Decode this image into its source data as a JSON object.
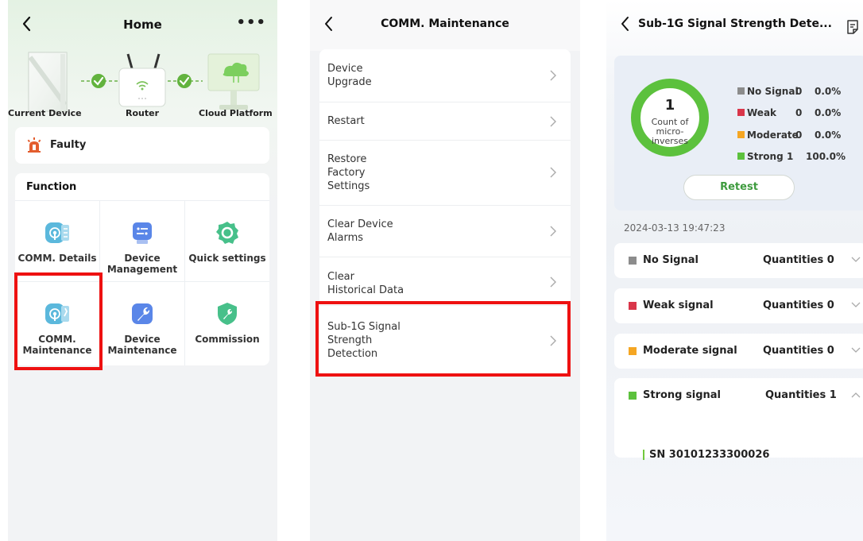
{
  "panel1": {
    "title": "Home",
    "more": "•••",
    "topology": {
      "current_device": "Current Device",
      "router": "Router",
      "cloud_platform": "Cloud Platform"
    },
    "status": {
      "label": "Faulty"
    },
    "function": {
      "header": "Function",
      "items": [
        {
          "label": "COMM. Details",
          "icon": "comm-details-icon"
        },
        {
          "label": "Device\nManagement",
          "icon": "device-management-icon"
        },
        {
          "label": "Quick settings",
          "icon": "gear-icon"
        },
        {
          "label": "COMM.\nMaintenance",
          "icon": "comm-maintenance-icon"
        },
        {
          "label": "Device\nMaintenance",
          "icon": "wrench-icon"
        },
        {
          "label": "Commission",
          "icon": "shield-wrench-icon"
        }
      ]
    }
  },
  "panel2": {
    "title": "COMM. Maintenance",
    "menu": [
      {
        "label": "Device\nUpgrade"
      },
      {
        "label": "Restart"
      },
      {
        "label": "Restore\nFactory\nSettings"
      },
      {
        "label": "Clear Device\nAlarms"
      },
      {
        "label": "Clear\nHistorical Data"
      },
      {
        "label": "Sub-1G Signal\nStrength\nDetection"
      }
    ]
  },
  "panel3": {
    "title": "Sub-1G Signal Strength Dete...",
    "summary": {
      "count": "1",
      "count_label": "Count of\nmicro-\ninverses",
      "legend": [
        {
          "name": "No Signal",
          "count": "0",
          "percent": "0.0%",
          "color": "#8c8c8c"
        },
        {
          "name": "Weak",
          "count": "0",
          "percent": "0.0%",
          "color": "#d9364a"
        },
        {
          "name": "Moderate",
          "count": "0",
          "percent": "0.0%",
          "color": "#f5a623"
        },
        {
          "name": "Strong",
          "count": "1",
          "percent": "100.0%",
          "color": "#5cc13d"
        }
      ],
      "retest_label": "Retest"
    },
    "timestamp": "2024-03-13 19:47:23",
    "groups": [
      {
        "label": "No Signal",
        "quantity": "Quantities 0",
        "color": "#8c8c8c",
        "expanded": false
      },
      {
        "label": "Weak signal",
        "quantity": "Quantities 0",
        "color": "#d9364a",
        "expanded": false
      },
      {
        "label": "Moderate signal",
        "quantity": "Quantities 0",
        "color": "#f5a623",
        "expanded": false
      },
      {
        "label": "Strong signal",
        "quantity": "Quantities 1",
        "color": "#5cc13d",
        "expanded": true
      }
    ],
    "strong_items": [
      {
        "sn": "SN 30101233300026"
      }
    ]
  },
  "colors": {
    "highlight": "#ee1111",
    "accent_green": "#5cc13d"
  }
}
